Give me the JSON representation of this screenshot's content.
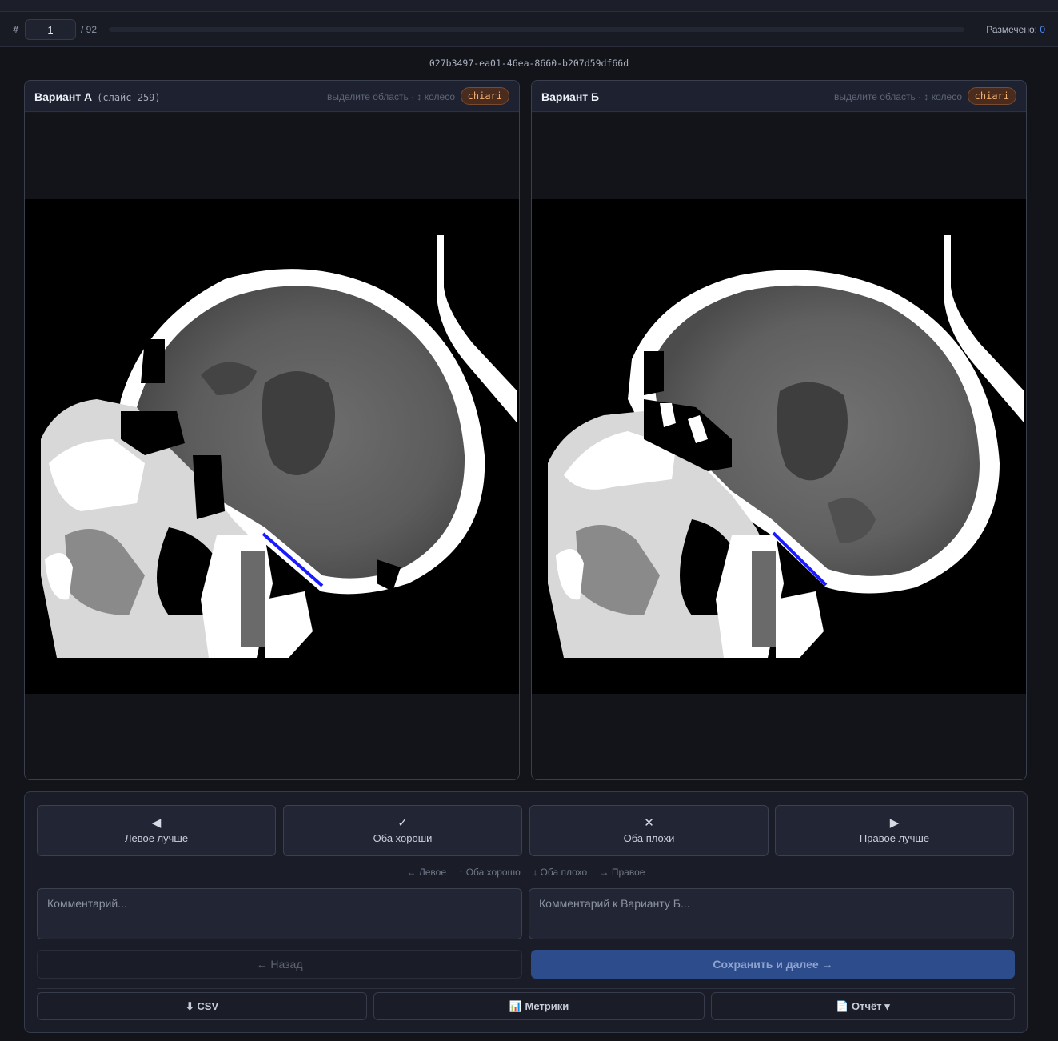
{
  "navbar": {
    "hash": "#",
    "index_value": "1",
    "total": "/ 92",
    "progress_fraction": 0,
    "marked_label": "Размечено:",
    "marked_count": "0"
  },
  "study_uid": "027b3497-ea01-46ea-8660-b207d59df66d",
  "panels": [
    {
      "title": "Вариант А",
      "slice": "(слайс 259)",
      "hint": "выделите область · ↕ колесо",
      "tag": "chiari"
    },
    {
      "title": "Вариант Б",
      "slice": "",
      "hint": "выделите область · ↕ колесо",
      "tag": "chiari"
    }
  ],
  "verdicts": [
    {
      "icon": "◀",
      "label": "Левое лучше"
    },
    {
      "icon": "✓",
      "label": "Оба хороши"
    },
    {
      "icon": "✕",
      "label": "Оба плохи"
    },
    {
      "icon": "▶",
      "label": "Правое лучше"
    }
  ],
  "shortcuts": [
    "← Левое",
    "↑ Оба хорошо",
    "↓ Оба плохо",
    "→ Правое"
  ],
  "comments": {
    "a_placeholder": "Комментарий...",
    "b_placeholder": "Комментарий к Варианту Б..."
  },
  "nav_buttons": {
    "back": "← Назад",
    "save": "Сохранить и далее →"
  },
  "tools": {
    "csv": "⬇ CSV",
    "metrics": "📊 Метрики",
    "report": "📄 Отчёт ▾"
  },
  "colors": {
    "accent": "#4c8df6",
    "tag_text": "#f2ae72",
    "measure_line": "#1a1aff"
  }
}
